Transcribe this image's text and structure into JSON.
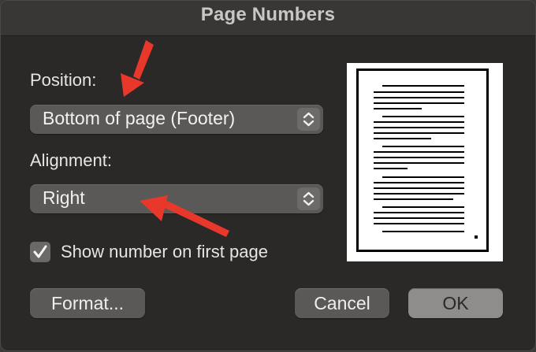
{
  "dialog": {
    "title": "Page Numbers"
  },
  "position": {
    "label": "Position:",
    "selected": "Bottom of page (Footer)"
  },
  "alignment": {
    "label": "Alignment:",
    "selected": "Right"
  },
  "first_page": {
    "label": "Show number on first page",
    "checked": true
  },
  "buttons": {
    "format": "Format...",
    "cancel": "Cancel",
    "ok": "OK"
  },
  "icons": {
    "stepper": "chevron-up-down-icon",
    "checkmark": "checkmark-icon",
    "arrow": "red-arrow-annotation"
  },
  "colors": {
    "annotation_arrow": "#e8382b",
    "dialog_bg": "#2a2928",
    "control_bg": "#5a5958"
  }
}
